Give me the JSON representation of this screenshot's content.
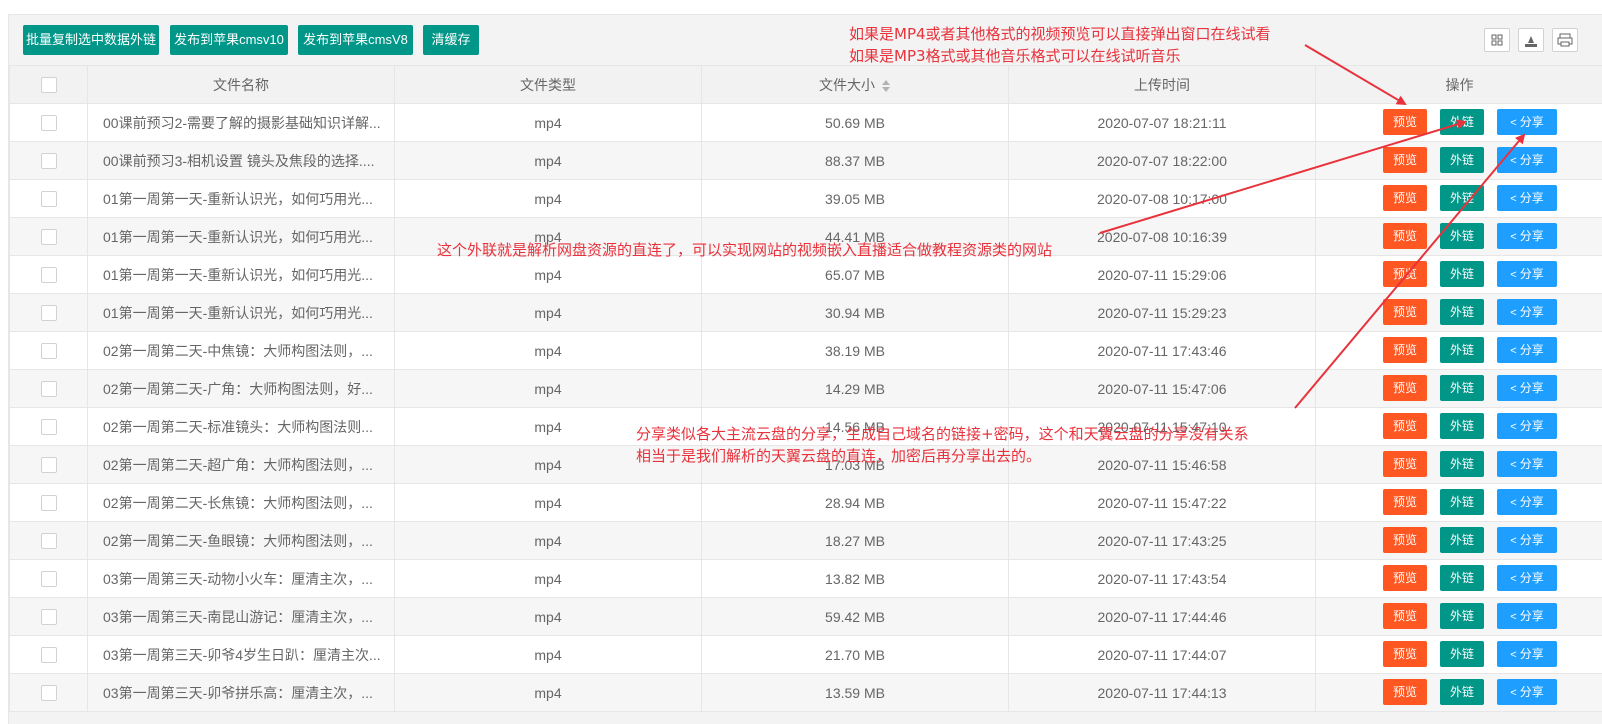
{
  "toolbar": {
    "batch_copy": "批量复制选中数据外链",
    "publish_v10": "发布到苹果cmsv10",
    "publish_v8": "发布到苹果cmsV8",
    "clear_cache": "清缓存"
  },
  "columns": {
    "name": "文件名称",
    "type": "文件类型",
    "size": "文件大小",
    "time": "上传时间",
    "ops": "操作"
  },
  "actions": {
    "preview": "预览",
    "external": "外链",
    "share": "分享"
  },
  "rows": [
    {
      "name": "00课前预习2-需要了解的摄影基础知识详解...",
      "type": "mp4",
      "size": "50.69 MB",
      "time": "2020-07-07 18:21:11"
    },
    {
      "name": "00课前预习3-相机设置 镜头及焦段的选择....",
      "type": "mp4",
      "size": "88.37 MB",
      "time": "2020-07-07 18:22:00"
    },
    {
      "name": "01第一周第一天-重新认识光，如何巧用光...",
      "type": "mp4",
      "size": "39.05 MB",
      "time": "2020-07-08 10:17:00"
    },
    {
      "name": "01第一周第一天-重新认识光，如何巧用光...",
      "type": "mp4",
      "size": "44.41 MB",
      "time": "2020-07-08 10:16:39"
    },
    {
      "name": "01第一周第一天-重新认识光，如何巧用光...",
      "type": "mp4",
      "size": "65.07 MB",
      "time": "2020-07-11 15:29:06"
    },
    {
      "name": "01第一周第一天-重新认识光，如何巧用光...",
      "type": "mp4",
      "size": "30.94 MB",
      "time": "2020-07-11 15:29:23"
    },
    {
      "name": "02第一周第二天-中焦镜：大师构图法则，...",
      "type": "mp4",
      "size": "38.19 MB",
      "time": "2020-07-11 17:43:46"
    },
    {
      "name": "02第一周第二天-广角：大师构图法则，好...",
      "type": "mp4",
      "size": "14.29 MB",
      "time": "2020-07-11 15:47:06"
    },
    {
      "name": "02第一周第二天-标准镜头：大师构图法则...",
      "type": "mp4",
      "size": "14.56 MB",
      "time": "2020-07-11 15:47:10"
    },
    {
      "name": "02第一周第二天-超广角：大师构图法则，...",
      "type": "mp4",
      "size": "17.03 MB",
      "time": "2020-07-11 15:46:58"
    },
    {
      "name": "02第一周第二天-长焦镜：大师构图法则，...",
      "type": "mp4",
      "size": "28.94 MB",
      "time": "2020-07-11 15:47:22"
    },
    {
      "name": "02第一周第二天-鱼眼镜：大师构图法则，...",
      "type": "mp4",
      "size": "18.27 MB",
      "time": "2020-07-11 17:43:25"
    },
    {
      "name": "03第一周第三天-动物小火车：厘清主次，...",
      "type": "mp4",
      "size": "13.82 MB",
      "time": "2020-07-11 17:43:54"
    },
    {
      "name": "03第一周第三天-南昆山游记：厘清主次，...",
      "type": "mp4",
      "size": "59.42 MB",
      "time": "2020-07-11 17:44:46"
    },
    {
      "name": "03第一周第三天-卯爷4岁生日趴：厘清主次...",
      "type": "mp4",
      "size": "21.70 MB",
      "time": "2020-07-11 17:44:07"
    },
    {
      "name": "03第一周第三天-卯爷拼乐高：厘清主次，...",
      "type": "mp4",
      "size": "13.59 MB",
      "time": "2020-07-11 17:44:13"
    }
  ],
  "annotations": {
    "preview_line1": "如果是MP4或者其他格式的视频预览可以直接弹出窗口在线试看",
    "preview_line2": "如果是MP3格式或其他音乐格式可以在线试听音乐",
    "external": "这个外联就是解析网盘资源的直连了，可以实现网站的视频嵌入直播适合做教程资源类的网站",
    "share_line1": "分享类似各大主流云盘的分享，生成自己域名的链接+密码，这个和天翼云盘的分享没有关系",
    "share_line2": "相当于是我们解析的天翼云盘的直连，加密后再分享出去的。"
  },
  "colors": {
    "primary": "#009688",
    "preview": "#ff5722",
    "share": "#1e9fff",
    "annotation": "#e8323c"
  }
}
